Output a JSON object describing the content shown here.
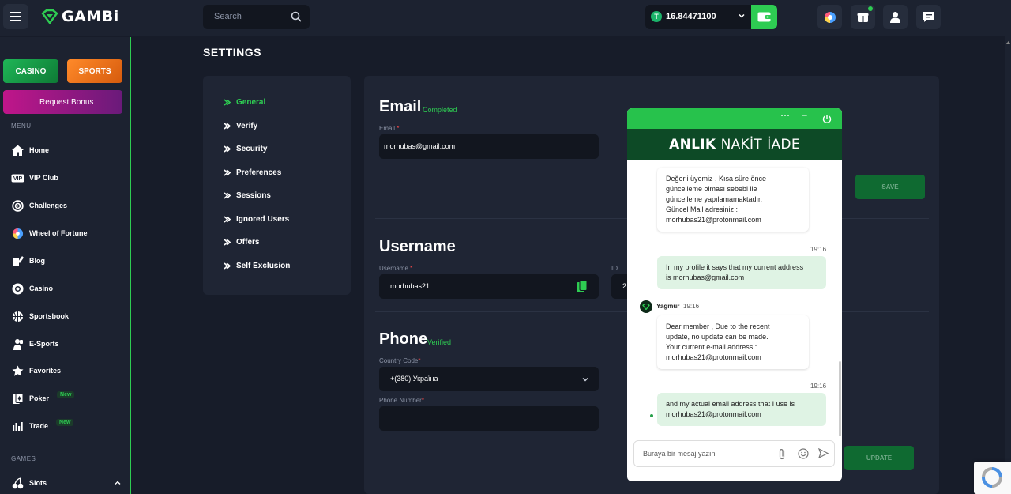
{
  "header": {
    "logo_text": "GAMBi",
    "search_placeholder": "Search",
    "balance_coin": "T",
    "balance_value": "16.84471100"
  },
  "sidebar": {
    "casino_label": "CASINO",
    "sports_label": "SPORTS",
    "bonus_label": "Request Bonus",
    "menu_label": "MENU",
    "items": [
      {
        "label": "Home",
        "icon": "home-icon"
      },
      {
        "label": "VIP Club",
        "icon": "vip-icon"
      },
      {
        "label": "Challenges",
        "icon": "target-icon"
      },
      {
        "label": "Wheel of Fortune",
        "icon": "wheel-icon"
      },
      {
        "label": "Blog",
        "icon": "blog-icon"
      },
      {
        "label": "Casino",
        "icon": "chip-icon"
      },
      {
        "label": "Sportsbook",
        "icon": "basketball-icon"
      },
      {
        "label": "E-Sports",
        "icon": "esports-icon"
      },
      {
        "label": "Favorites",
        "icon": "star-icon"
      },
      {
        "label": "Poker",
        "icon": "poker-icon",
        "badge": "New"
      },
      {
        "label": "Trade",
        "icon": "trade-icon",
        "badge": "New"
      }
    ],
    "games_label": "GAMES",
    "games_items": [
      {
        "label": "Slots",
        "icon": "cherry-icon"
      }
    ]
  },
  "main": {
    "page_title": "SETTINGS",
    "nav": [
      {
        "label": "General",
        "active": true
      },
      {
        "label": "Verify"
      },
      {
        "label": "Security"
      },
      {
        "label": "Preferences"
      },
      {
        "label": "Sessions"
      },
      {
        "label": "Ignored Users"
      },
      {
        "label": "Offers"
      },
      {
        "label": "Self Exclusion"
      }
    ],
    "email": {
      "title": "Email",
      "status": "Completed",
      "label": "Email",
      "required": "*",
      "value": "morhubas@gmail.com",
      "save_label": "SAVE"
    },
    "username": {
      "title": "Username",
      "label": "Username",
      "required": "*",
      "value": "morhubas21",
      "id_label": "ID",
      "id_value": "2"
    },
    "phone": {
      "title": "Phone",
      "status": "Verified",
      "country_label": "Country Code",
      "country_value": "+(380) Україна",
      "number_label": "Phone Number",
      "required": "*",
      "update_label": "UPDATE"
    }
  },
  "chat": {
    "banner_bold": "ANLIK",
    "banner_thin1": "NAKİT",
    "banner_thin2": "İADE",
    "messages": [
      {
        "dir": "in",
        "lines": [
          "Değerli üyemiz , Kısa süre önce",
          "güncelleme olması sebebi ile",
          "güncelleme yapılamamaktadır.",
          "Güncel Mail adresiniz :",
          "morhubas21@protonmail.com"
        ]
      },
      {
        "dir": "out",
        "time": "19:16",
        "lines": [
          "In my profile it says that my current address",
          "is morhubas@gmail.com"
        ]
      },
      {
        "dir": "in",
        "agent": "Yağmur",
        "time": "19:16",
        "lines": [
          "Dear member , Due to the recent",
          "update, no update can be made.",
          "Your current e-mail address :",
          "morhubas21@protonmail.com"
        ]
      },
      {
        "dir": "out",
        "time": "19:16",
        "lines": [
          "and my actual email address that I use is",
          "morhubas21@protonmail.com"
        ]
      }
    ],
    "input_placeholder": "Buraya bir mesaj yazın"
  },
  "colors": {
    "accent": "#2ecc52",
    "bg": "#171c29",
    "panel": "#1f2534"
  }
}
